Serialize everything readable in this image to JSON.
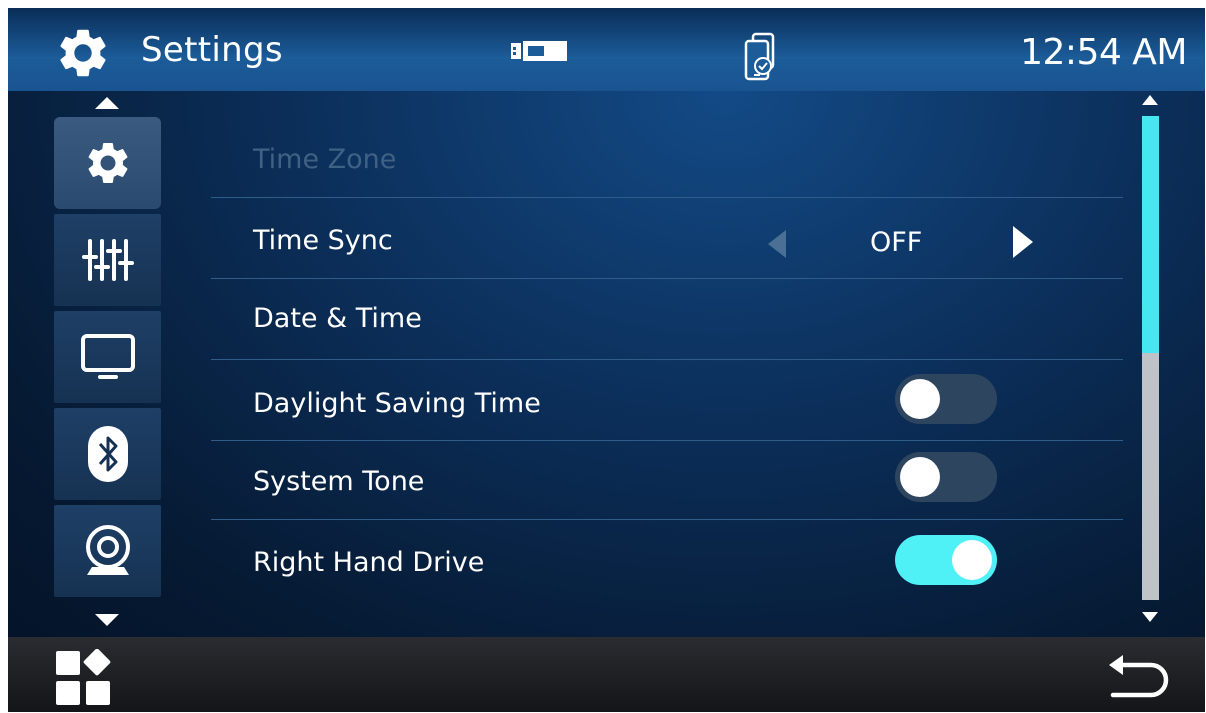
{
  "header": {
    "title": "Settings",
    "time": "12:54 AM",
    "icons": [
      "gear-icon",
      "usb-icon",
      "phone-sync-icon"
    ]
  },
  "sidebar": {
    "items": [
      {
        "name": "general",
        "icon": "gear-icon",
        "active": true
      },
      {
        "name": "audio",
        "icon": "equalizer-icon",
        "active": false
      },
      {
        "name": "display",
        "icon": "monitor-icon",
        "active": false
      },
      {
        "name": "bluetooth",
        "icon": "bluetooth-icon",
        "active": false
      },
      {
        "name": "camera",
        "icon": "camera-icon",
        "active": false
      }
    ]
  },
  "settings": {
    "time_zone": {
      "label": "Time Zone",
      "disabled": true
    },
    "time_sync": {
      "label": "Time Sync",
      "value": "OFF"
    },
    "date_time": {
      "label": "Date & Time"
    },
    "daylight_saving": {
      "label": "Daylight Saving Time",
      "on": false
    },
    "system_tone": {
      "label": "System Tone",
      "on": false
    },
    "right_hand_drive": {
      "label": "Right Hand Drive",
      "on": true
    }
  },
  "scrollbar": {
    "position_fraction": 0.0,
    "visible_fraction": 0.49
  },
  "footer": {
    "icons": [
      "apps-grid-icon",
      "back-icon"
    ]
  },
  "colors": {
    "accent": "#4ff0f6",
    "header_blue": "#1b5c99",
    "dim_text": "#3e6184"
  }
}
